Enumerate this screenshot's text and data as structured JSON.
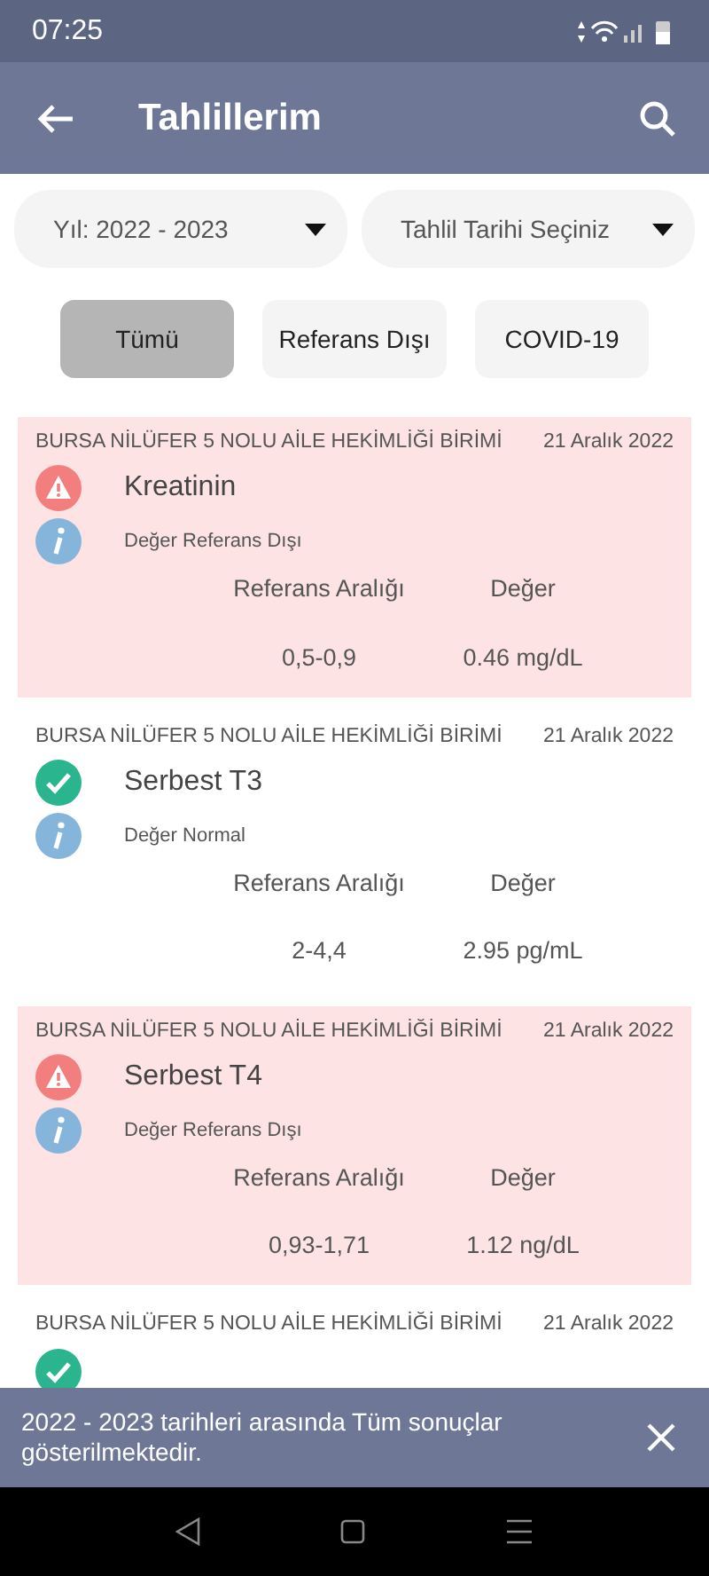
{
  "status_bar": {
    "time": "07:25"
  },
  "app_bar": {
    "title": "Tahlillerim"
  },
  "filters": [
    {
      "label": "Yıl: 2022 - 2023"
    },
    {
      "label": "Tahlil Tarihi Seçiniz"
    }
  ],
  "chips": [
    {
      "label": "Tümü",
      "selected": true
    },
    {
      "label": "Referans Dışı",
      "selected": false
    },
    {
      "label": "COVID-19",
      "selected": false
    }
  ],
  "results": [
    {
      "facility": "BURSA NİLÜFER 5 NOLU AİLE HEKİMLİĞİ BİRİMİ",
      "date": "21 Aralık 2022",
      "kind": "out",
      "name": "Kreatinin",
      "status_text": "Değer Referans Dışı",
      "range_label": "Referans Aralığı",
      "value_label": "Değer",
      "range": "0,5-0,9",
      "value": "0.46 mg/dL"
    },
    {
      "facility": "BURSA NİLÜFER 5 NOLU AİLE HEKİMLİĞİ BİRİMİ",
      "date": "21 Aralık 2022",
      "kind": "normal",
      "name": "Serbest T3",
      "status_text": "Değer Normal",
      "range_label": "Referans Aralığı",
      "value_label": "Değer",
      "range": "2-4,4",
      "value": "2.95 pg/mL"
    },
    {
      "facility": "BURSA NİLÜFER 5 NOLU AİLE HEKİMLİĞİ BİRİMİ",
      "date": "21 Aralık 2022",
      "kind": "out",
      "name": "Serbest T4",
      "status_text": "Değer Referans Dışı",
      "range_label": "Referans Aralığı",
      "value_label": "Değer",
      "range": "0,93-1,71",
      "value": "1.12 ng/dL"
    },
    {
      "facility": "BURSA NİLÜFER 5 NOLU AİLE HEKİMLİĞİ BİRİMİ",
      "date": "21 Aralık 2022",
      "kind": "normal"
    }
  ],
  "snackbar": {
    "message": "2022 - 2023 tarihleri arasında Tüm sonuçlar gösterilmektedir."
  }
}
